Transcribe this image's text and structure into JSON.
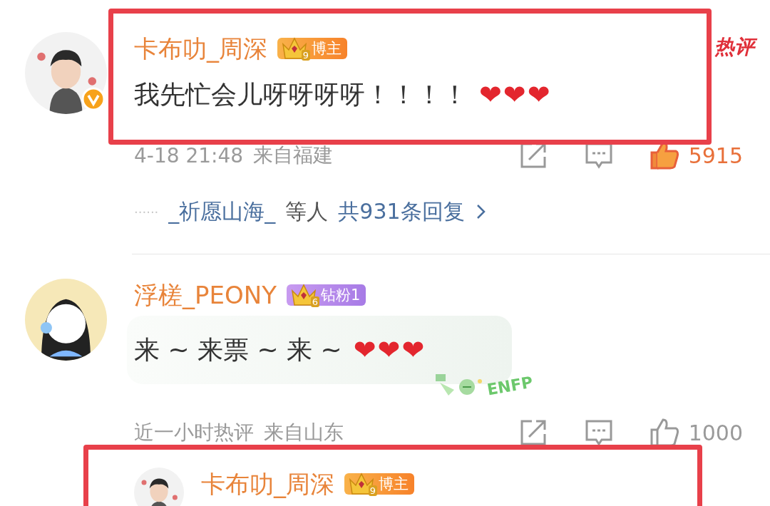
{
  "comments": [
    {
      "user": "卡布叻_周深",
      "verified": true,
      "badge": {
        "kind": "blogger",
        "crown_level": "9",
        "label": "博主"
      },
      "hot_label": "热评",
      "text": "我先忙会儿呀呀呀呀！！！！",
      "emoji": [
        "❤",
        "❤",
        "❤"
      ],
      "bubble": false,
      "time": "4-18 21:48",
      "location": "来自福建",
      "likes": "5915",
      "liked": true,
      "replies": {
        "dots": "······",
        "user": "_祈愿山海_",
        "suffix": "等人",
        "total": "共931条回复"
      },
      "highlighted": true
    },
    {
      "user": "浮槎_PEONY",
      "verified": false,
      "badge": {
        "kind": "diamond_fan",
        "crown_level": "6",
        "label": "钻粉1"
      },
      "text": "来 ~ 来票 ~ 来 ~",
      "emoji": [
        "❤",
        "❤",
        "❤"
      ],
      "bubble": true,
      "sticker": "ENFP",
      "time": "近一小时热评",
      "location": "来自山东",
      "likes": "1000",
      "liked": false,
      "highlighted": false
    },
    {
      "user": "卡布叻_周深",
      "verified": false,
      "badge": {
        "kind": "blogger",
        "crown_level": "9",
        "label": "博主"
      },
      "highlighted": true
    }
  ]
}
